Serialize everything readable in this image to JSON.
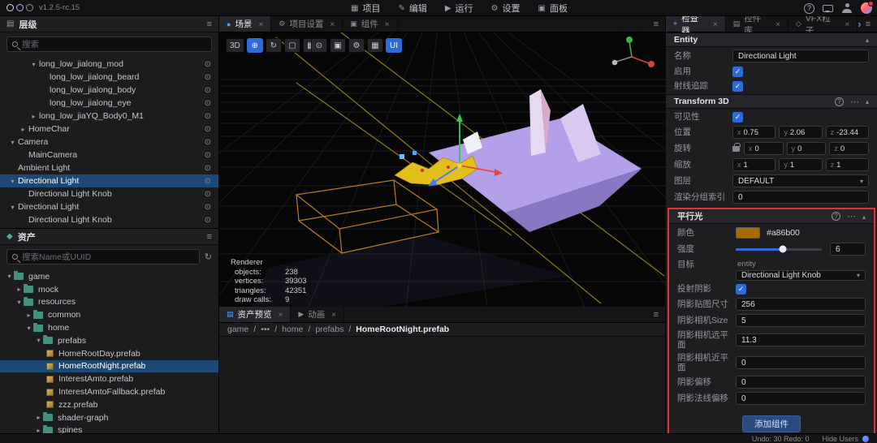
{
  "topbar": {
    "version": "v1.2.5-rc.15",
    "menu": [
      {
        "icon": "▦",
        "label": "项目"
      },
      {
        "icon": "✎",
        "label": "编辑"
      },
      {
        "icon": "▶",
        "label": "运行"
      },
      {
        "icon": "⚙",
        "label": "设置"
      },
      {
        "icon": "▣",
        "label": "面板"
      }
    ]
  },
  "hierarchy": {
    "title": "层级",
    "search_placeholder": "搜索",
    "items": [
      {
        "arrow": "▾",
        "label": "long_low_jialong_mod"
      },
      {
        "arrow": "",
        "label": "long_low_jialong_beard"
      },
      {
        "arrow": "",
        "label": "long_low_jialong_body"
      },
      {
        "arrow": "",
        "label": "long_low_jialong_eye"
      },
      {
        "arrow": "▸",
        "label": "long_low_jiaYQ_Body0_M1"
      },
      {
        "arrow": "▸",
        "label": "HomeChar"
      },
      {
        "arrow": "▾",
        "label": "Camera"
      },
      {
        "arrow": "",
        "label": "MainCamera"
      },
      {
        "arrow": "",
        "label": "Ambient Light"
      },
      {
        "arrow": "▾",
        "label": "Directional Light",
        "selected": true
      },
      {
        "arrow": "",
        "label": "Directional Light Knob"
      },
      {
        "arrow": "▾",
        "label": "Directional Light"
      },
      {
        "arrow": "",
        "label": "Directional Light Knob"
      }
    ]
  },
  "assets": {
    "title": "资产",
    "search_placeholder": "搜索Name或UUID",
    "items": [
      {
        "arrow": "▾",
        "type": "folder",
        "label": "game"
      },
      {
        "arrow": "▸",
        "type": "folder",
        "label": "mock"
      },
      {
        "arrow": "▾",
        "type": "folder",
        "label": "resources"
      },
      {
        "arrow": "▸",
        "type": "folder",
        "label": "common"
      },
      {
        "arrow": "▾",
        "type": "folder",
        "label": "home"
      },
      {
        "arrow": "▾",
        "type": "folder",
        "label": "prefabs"
      },
      {
        "arrow": "",
        "type": "prefab",
        "label": "HomeRootDay.prefab"
      },
      {
        "arrow": "",
        "type": "prefab",
        "label": "HomeRootNight.prefab",
        "selected": true
      },
      {
        "arrow": "",
        "type": "prefab",
        "label": "InterestAmto.prefab"
      },
      {
        "arrow": "",
        "type": "prefab",
        "label": "InterestAmtoFallback.prefab"
      },
      {
        "arrow": "",
        "type": "prefab",
        "label": "zzz.prefab"
      },
      {
        "arrow": "▸",
        "type": "folder",
        "label": "shader-graph"
      },
      {
        "arrow": "▸",
        "type": "folder",
        "label": "spines"
      }
    ]
  },
  "scene": {
    "tabs": [
      {
        "label": "场景"
      },
      {
        "label": "项目设置"
      },
      {
        "label": "组件"
      }
    ],
    "toolbar": {
      "mode": "3D",
      "ui": "UI"
    },
    "stats": {
      "title": "Renderer",
      "lines": [
        {
          "label": "objects:",
          "value": "238"
        },
        {
          "label": "vertices:",
          "value": "39303"
        },
        {
          "label": "triangles:",
          "value": "42351"
        },
        {
          "label": "draw calls:",
          "value": "9"
        }
      ]
    }
  },
  "preview": {
    "tabs": [
      {
        "label": "资产预览"
      },
      {
        "label": "动画"
      }
    ],
    "sep": "/",
    "breadcrumb": [
      "game",
      "•••",
      "home",
      "prefabs",
      "HomeRootNight.prefab"
    ]
  },
  "inspector": {
    "tabs": [
      {
        "label": "检查器"
      },
      {
        "label": "控件库"
      },
      {
        "label": "VFX粒子"
      }
    ],
    "entity": {
      "title": "Entity",
      "name_label": "名称",
      "name_value": "Directional Light",
      "enabled_label": "启用",
      "raycast_label": "射线追踪"
    },
    "transform": {
      "title": "Transform 3D",
      "visible_label": "可见性",
      "axes": [
        "x",
        "y",
        "z"
      ],
      "position": {
        "label": "位置",
        "x": "0.75",
        "y": "2.06",
        "z": "-23.44"
      },
      "rotation": {
        "label": "旋转",
        "x": "0",
        "y": "0",
        "z": "0"
      },
      "scale": {
        "label": "缩放",
        "x": "1",
        "y": "1",
        "z": "1"
      },
      "layer_label": "图层",
      "layer_value": "DEFAULT",
      "render_group_label": "渲染分组索引",
      "render_group_value": "0"
    },
    "light": {
      "title": "平行光",
      "color_label": "颜色",
      "color_hex": "#a86b00",
      "intensity_label": "强度",
      "intensity_value": "6",
      "target_label": "目标",
      "target_type": "entity",
      "target_value": "Directional Light Knob",
      "cast_shadow_label": "投射阴影",
      "fields": [
        {
          "label": "阴影贴图尺寸",
          "value": "256"
        },
        {
          "label": "阴影相机Size",
          "value": "5"
        },
        {
          "label": "阴影相机远平面",
          "value": "11.3"
        },
        {
          "label": "阴影相机近平面",
          "value": "0"
        },
        {
          "label": "阴影偏移",
          "value": "0"
        },
        {
          "label": "阴影法线偏移",
          "value": "0"
        }
      ],
      "add_component": "添加组件"
    }
  },
  "statusbar": {
    "undo": "Undo: 30 Redo: 0",
    "users": "Hide Users"
  }
}
